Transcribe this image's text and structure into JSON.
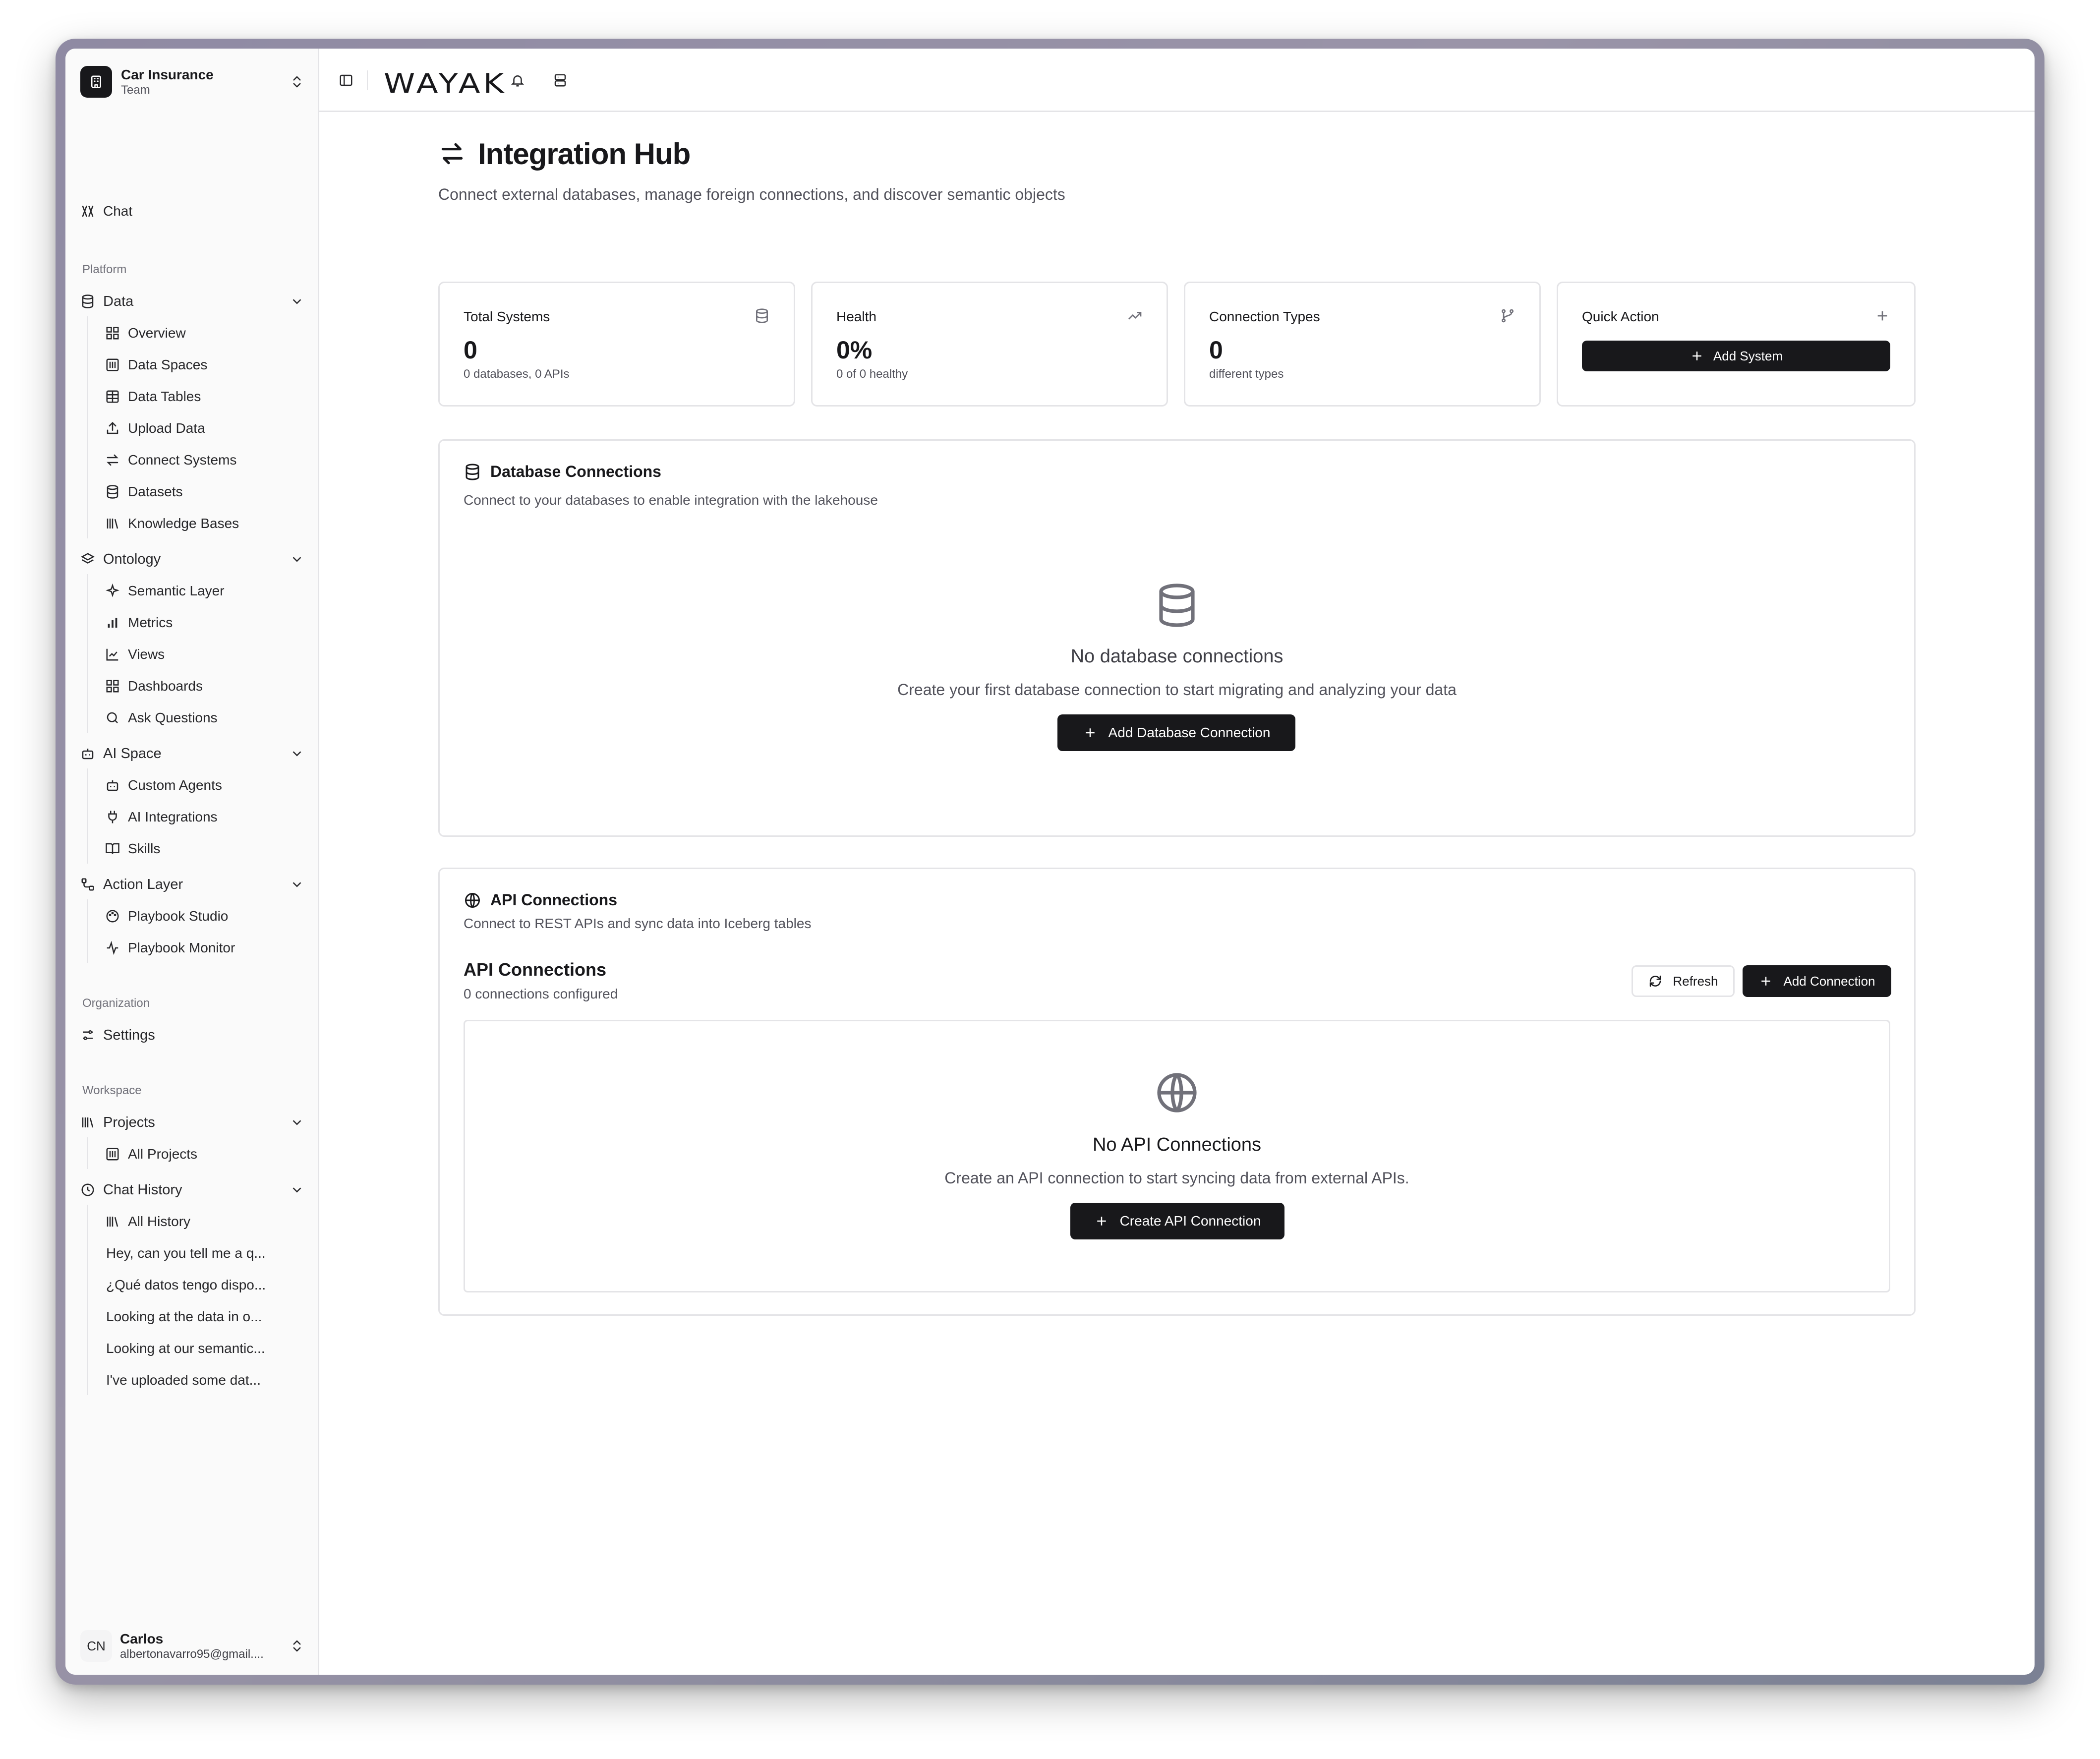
{
  "team": {
    "name": "Car Insurance",
    "subtitle": "Team"
  },
  "nav": {
    "chat": "Chat",
    "platform_label": "Platform",
    "data": {
      "label": "Data",
      "items": [
        "Overview",
        "Data Spaces",
        "Data Tables",
        "Upload Data",
        "Connect Systems",
        "Datasets",
        "Knowledge Bases"
      ]
    },
    "ontology": {
      "label": "Ontology",
      "items": [
        "Semantic Layer",
        "Metrics",
        "Views",
        "Dashboards",
        "Ask Questions"
      ]
    },
    "ai_space": {
      "label": "AI Space",
      "items": [
        "Custom Agents",
        "AI Integrations",
        "Skills"
      ]
    },
    "action_layer": {
      "label": "Action Layer",
      "items": [
        "Playbook Studio",
        "Playbook Monitor"
      ]
    },
    "organization_label": "Organization",
    "settings": "Settings",
    "workspace_label": "Workspace",
    "projects": {
      "label": "Projects",
      "items": [
        "All Projects"
      ]
    },
    "chat_history": {
      "label": "Chat History",
      "all": "All History",
      "items": [
        "Hey, can you tell me a q...",
        "¿Qué datos tengo dispo...",
        "Looking at the data in o...",
        "Looking at our semantic...",
        "I've uploaded some dat..."
      ]
    }
  },
  "user": {
    "initials": "CN",
    "name": "Carlos",
    "email": "albertonavarro95@gmail...."
  },
  "brand": "WAYAK",
  "page": {
    "title": "Integration Hub",
    "description": "Connect external databases, manage foreign connections, and discover semantic objects"
  },
  "stats": [
    {
      "title": "Total Systems",
      "value": "0",
      "sub": "0 databases, 0 APIs",
      "icon": "database-icon"
    },
    {
      "title": "Health",
      "value": "0%",
      "sub": "0 of 0 healthy",
      "icon": "trending-up-icon"
    },
    {
      "title": "Connection Types",
      "value": "0",
      "sub": "different types",
      "icon": "git-branch-icon"
    }
  ],
  "quick_action": {
    "title": "Quick Action",
    "button": "Add System"
  },
  "db_section": {
    "title": "Database Connections",
    "description": "Connect to your databases to enable integration with the lakehouse",
    "empty_title": "No database connections",
    "empty_desc": "Create your first database connection to start migrating and analyzing your data",
    "button": "Add Database Connection"
  },
  "api_section": {
    "title": "API Connections",
    "description": "Connect to REST APIs and sync data into Iceberg tables",
    "list_title": "API Connections",
    "list_count": "0 connections configured",
    "refresh": "Refresh",
    "add": "Add Connection",
    "empty_title": "No API Connections",
    "empty_desc": "Create an API connection to start syncing data from external APIs.",
    "button": "Create API Connection"
  }
}
